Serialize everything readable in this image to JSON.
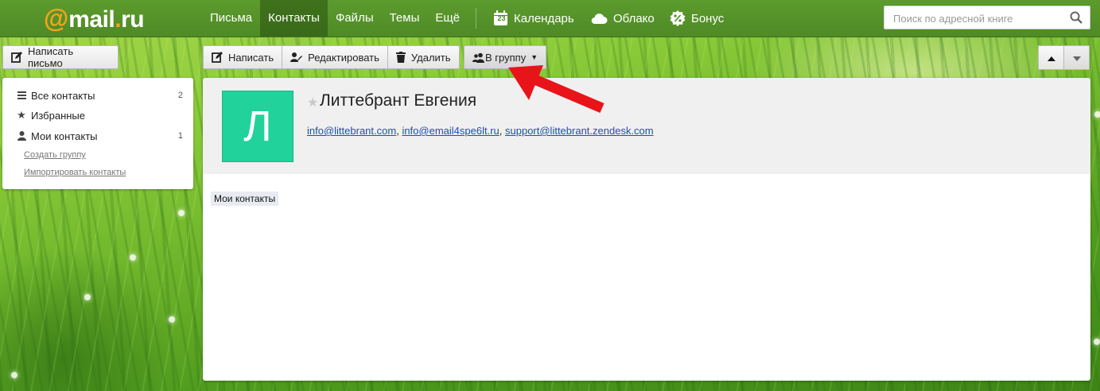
{
  "brand": {
    "at": "@",
    "name": "mail",
    "dot": ".",
    "tld": "ru"
  },
  "nav": {
    "items": [
      "Письма",
      "Контакты",
      "Файлы",
      "Темы",
      "Ещё"
    ],
    "active": "Контакты",
    "services": [
      {
        "label": "Календарь",
        "icon": "calendar-icon",
        "icon_text": "23"
      },
      {
        "label": "Облако",
        "icon": "cloud-icon"
      },
      {
        "label": "Бонус",
        "icon": "bonus-icon"
      }
    ]
  },
  "search": {
    "placeholder": "Поиск по адресной книге",
    "value": ""
  },
  "compose_button": "Написать письмо",
  "toolbar": {
    "write": "Написать",
    "edit": "Редактировать",
    "delete": "Удалить",
    "to_group": "В группу"
  },
  "sidebar": {
    "items": [
      {
        "label": "Все контакты",
        "icon": "list-icon",
        "count": "2"
      },
      {
        "label": "Избранные",
        "icon": "star-icon",
        "count": ""
      },
      {
        "label": "Мои контакты",
        "icon": "person-icon",
        "count": "1"
      }
    ],
    "links": [
      "Создать группу",
      "Импортировать контакты"
    ]
  },
  "contact": {
    "initial": "Л",
    "name": "Литтебрант Евгения",
    "emails": [
      "info@littebrant.com",
      "info@email4spe6lt.ru",
      "support@littebrant.zendesk.com"
    ],
    "group_tag": "Мои контакты"
  },
  "colors": {
    "brand_orange": "#f7a31c",
    "topbar_green": "#5c9b2e",
    "avatar_green": "#21d29b",
    "link_blue": "#1a4fb8",
    "annotation_red": "#e8141a"
  }
}
